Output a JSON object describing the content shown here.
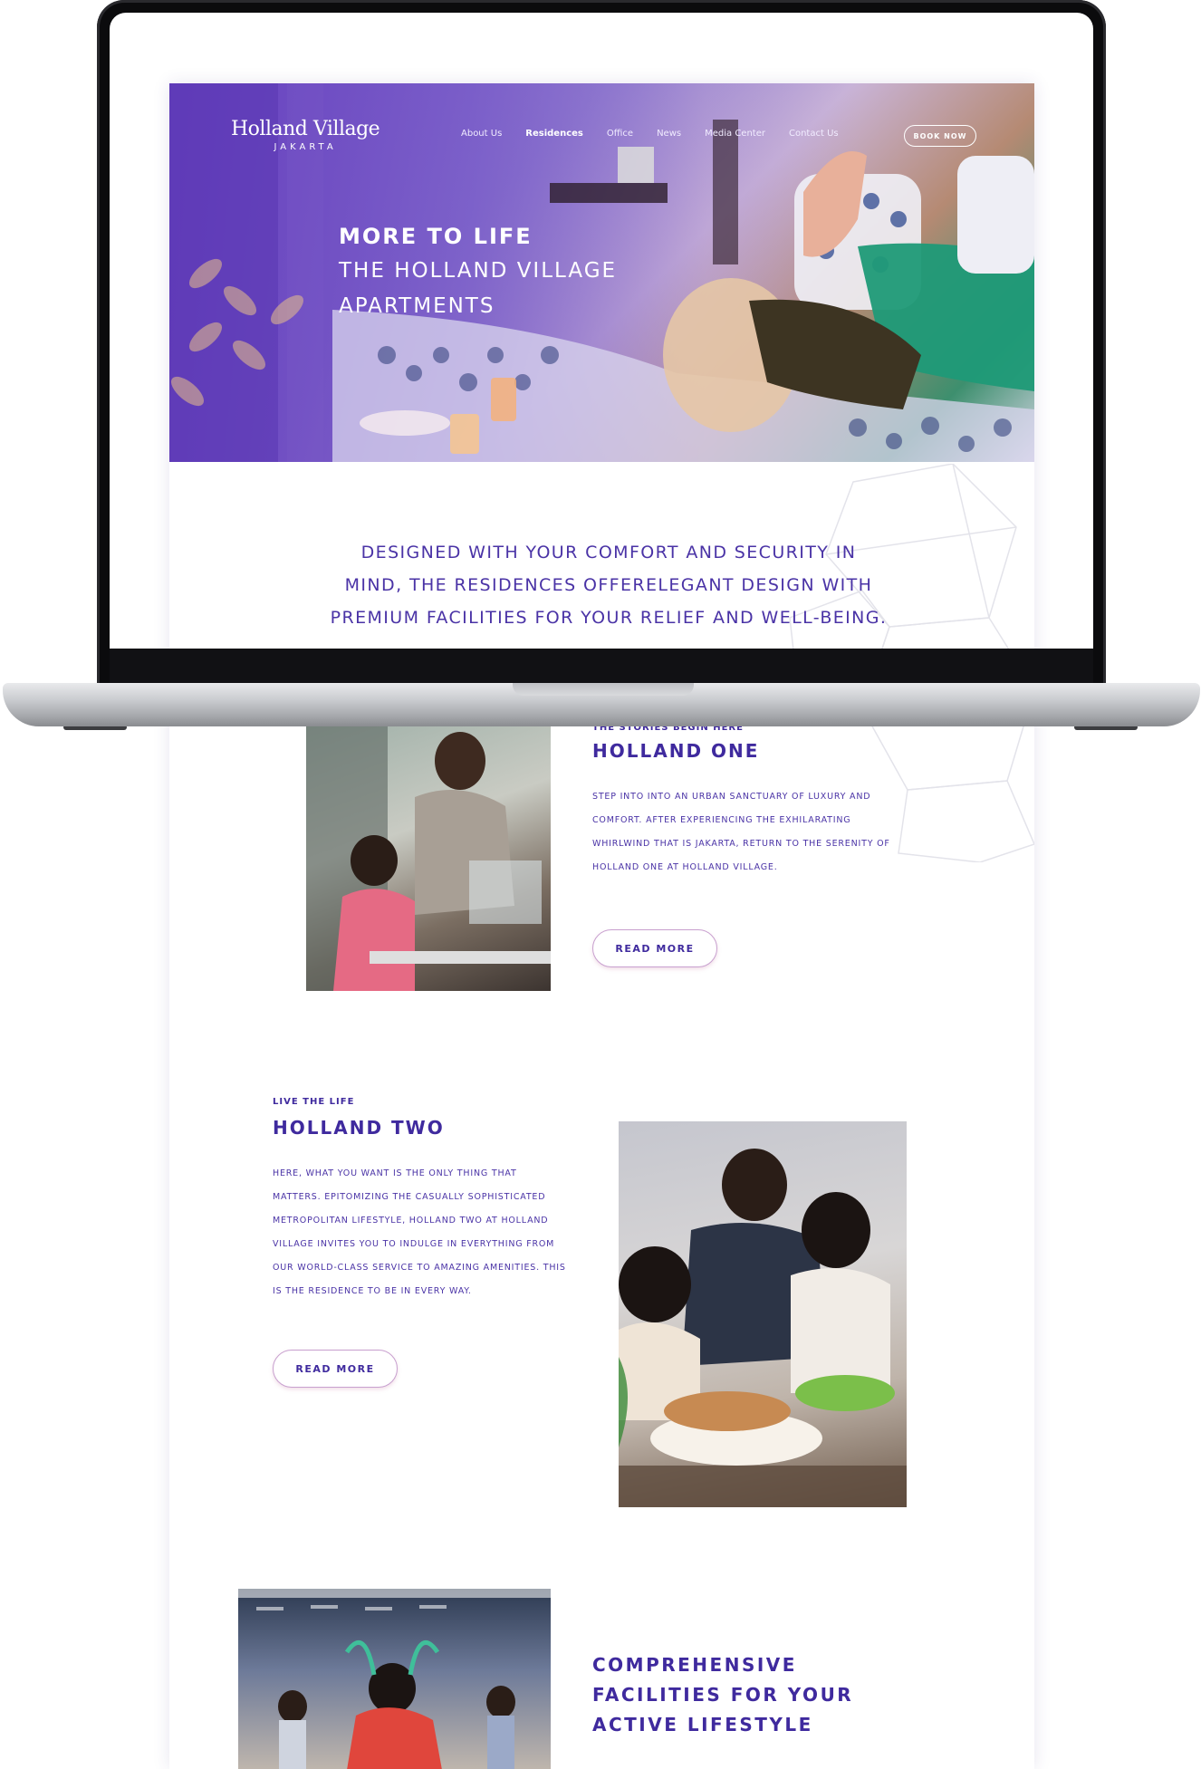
{
  "brand": {
    "name": "Holland Village",
    "sub": "JAKARTA"
  },
  "nav": {
    "items": [
      "About Us",
      "Residences",
      "Office",
      "News",
      "Media Center",
      "Contact Us"
    ],
    "active": "Residences",
    "cta": "BOOK NOW"
  },
  "hero": {
    "line1": "MORE TO LIFE",
    "line2": "THE HOLLAND VILLAGE",
    "line3": "APARTMENTS"
  },
  "intro": {
    "line1": "DESIGNED WITH YOUR COMFORT AND SECURITY IN",
    "line2": "MIND, THE RESIDENCES OFFERELEGANT DESIGN WITH",
    "line3": "PREMIUM FACILITIES FOR YOUR RELIEF AND WELL-BEING."
  },
  "holland_one": {
    "eyebrow": "THE STORIES BEGIN HERE",
    "title": "HOLLAND ONE",
    "body": [
      "STEP INTO INTO AN URBAN SANCTUARY OF LUXURY AND",
      "COMFORT. AFTER EXPERIENCING THE EXHILARATING",
      "WHIRLWIND THAT IS JAKARTA, RETURN TO THE SERENITY OF",
      "HOLLAND ONE AT HOLLAND VILLAGE."
    ],
    "button": "READ MORE"
  },
  "holland_two": {
    "eyebrow": "LIVE THE LIFE",
    "title": "HOLLAND TWO",
    "body": [
      "HERE, WHAT YOU WANT IS THE ONLY THING THAT",
      "MATTERS. EPITOMIZING THE CASUALLY SOPHISTICATED",
      "METROPOLITAN LIFESTYLE, HOLLAND TWO AT HOLLAND",
      "VILLAGE INVITES YOU TO INDULGE IN EVERYTHING FROM",
      "OUR WORLD-CLASS SERVICE TO AMAZING AMENITIES. THIS",
      "IS THE RESIDENCE TO BE IN EVERY WAY."
    ],
    "button": "READ MORE"
  },
  "facilities": {
    "line1": "COMPREHENSIVE",
    "line2": "FACILITIES FOR YOUR",
    "line3": "ACTIVE LIFESTYLE"
  },
  "colors": {
    "brand_purple": "#3f2a9e",
    "hero_purple": "#6a47c4",
    "button_border": "#c8a0cf"
  }
}
